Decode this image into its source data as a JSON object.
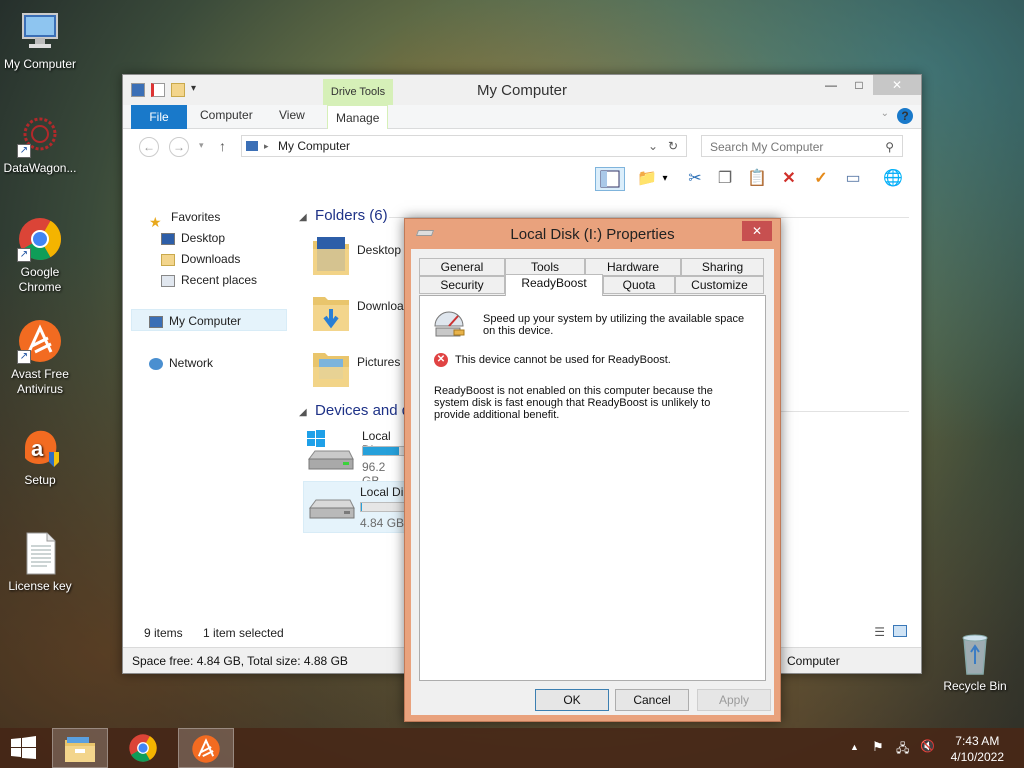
{
  "desktop": {
    "icons": [
      {
        "label": "My Computer"
      },
      {
        "label": "DataWagon..."
      },
      {
        "label": "Google Chrome"
      },
      {
        "label": "Avast Free Antivirus"
      },
      {
        "label": "Setup"
      },
      {
        "label": "License key"
      },
      {
        "label": "Recycle Bin"
      }
    ]
  },
  "explorer": {
    "title": "My Computer",
    "contextual_tab_group": "Drive Tools",
    "ribbon_tabs": [
      "File",
      "Computer",
      "View",
      "Manage"
    ],
    "address": "My Computer",
    "search_placeholder": "Search My Computer",
    "nav": {
      "favorites": "Favorites",
      "desktop": "Desktop",
      "downloads": "Downloads",
      "recent": "Recent places",
      "my_computer": "My Computer",
      "network": "Network"
    },
    "folders_header": "Folders (6)",
    "folders": [
      "Desktop",
      "Downloa",
      "Pictures"
    ],
    "devices_header": "Devices and d",
    "drives": [
      {
        "name": "Local Di",
        "size": "96.2 GB",
        "fill_percent": 40
      },
      {
        "name": "Local Di",
        "size": "4.84 GB",
        "fill_percent": 1
      }
    ],
    "status_items": "9 items",
    "status_selected": "1 item selected",
    "details": "Space free: 4.84 GB, Total size: 4.88 GB",
    "details_right": "Computer"
  },
  "dialog": {
    "title": "Local Disk (I:) Properties",
    "tabs_row1": [
      "General",
      "Tools",
      "Hardware",
      "Sharing"
    ],
    "tabs_row2": [
      "Security",
      "ReadyBoost",
      "Quota",
      "Customize"
    ],
    "intro": "Speed up your system by utilizing the available space on this device.",
    "error": "This device cannot be used for ReadyBoost.",
    "explanation": "ReadyBoost is not enabled on this computer because the system disk is fast enough that ReadyBoost is unlikely to provide additional benefit.",
    "ok": "OK",
    "cancel": "Cancel",
    "apply": "Apply"
  },
  "taskbar": {
    "time": "7:43 AM",
    "date": "4/10/2022"
  }
}
